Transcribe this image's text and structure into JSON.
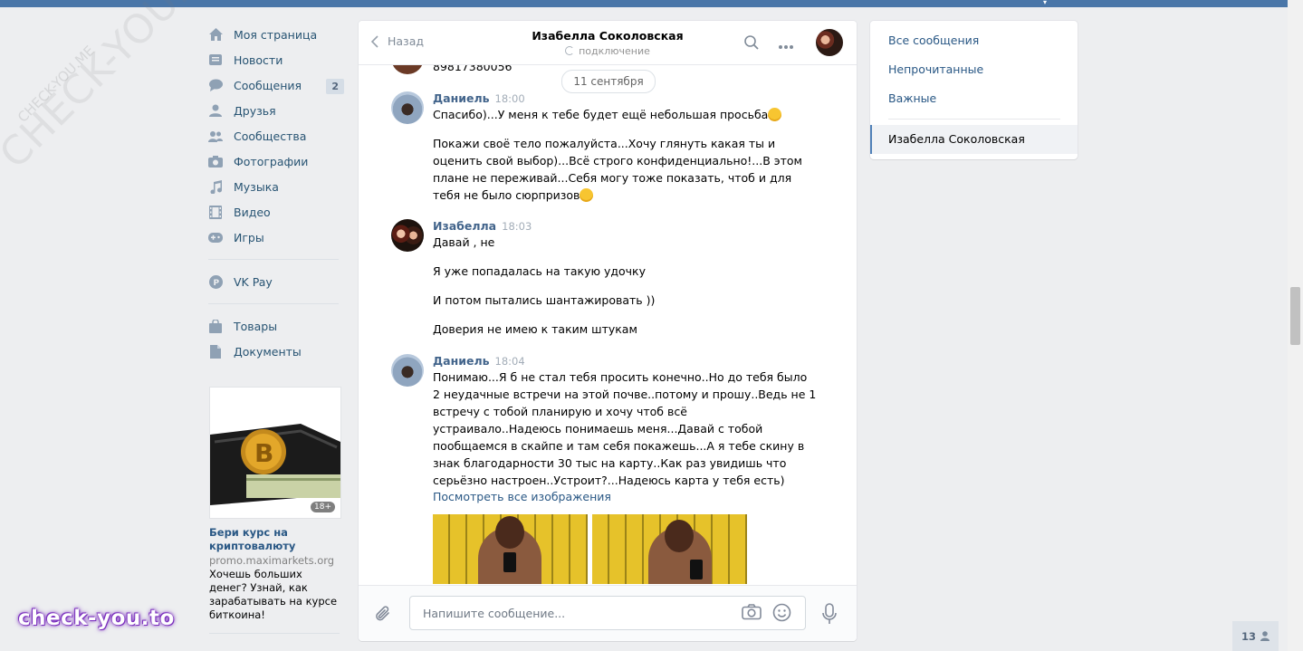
{
  "watermark": {
    "big": "CHECK-YOU.ME",
    "small": "CHECK-YOU.ME",
    "logo": "check-you.to"
  },
  "nav": {
    "items": [
      {
        "label": "Моя страница",
        "icon": "home-icon"
      },
      {
        "label": "Новости",
        "icon": "news-icon"
      },
      {
        "label": "Сообщения",
        "icon": "messages-icon",
        "badge": "2"
      },
      {
        "label": "Друзья",
        "icon": "friends-icon"
      },
      {
        "label": "Сообщества",
        "icon": "groups-icon"
      },
      {
        "label": "Фотографии",
        "icon": "camera-icon"
      },
      {
        "label": "Музыка",
        "icon": "music-icon"
      },
      {
        "label": "Видео",
        "icon": "video-icon"
      },
      {
        "label": "Игры",
        "icon": "games-icon"
      }
    ],
    "pay": {
      "label": "VK Pay",
      "icon": "vkpay-icon"
    },
    "extra": [
      {
        "label": "Товары",
        "icon": "bag-icon"
      },
      {
        "label": "Документы",
        "icon": "document-icon"
      }
    ]
  },
  "ad": {
    "age": "18+",
    "title": "Бери курс на криптовалюту",
    "domain": "promo.maximarkets.org",
    "text": "Хочешь больших денег? Узнай, как зарабатывать на курсе биткоина!"
  },
  "chat": {
    "back_label": "Назад",
    "title": "Изабелла Соколовская",
    "status": "подключение",
    "date_pill": "11 сентября",
    "cut_text": "89817380056",
    "messages": [
      {
        "author": "Даниель",
        "time": "18:00",
        "lines": [
          "Спасибо)...У меня к тебе будет ещё небольшая просьба",
          "Покажи своё тело пожалуйста...Хочу глянуть какая ты и",
          "оценить свой выбор)...Всё строго конфиденциально!...В этом",
          "плане не переживай...Себя могу тоже показать, чтоб и для",
          "тебя не было сюрпризов"
        ]
      },
      {
        "author": "Изабелла",
        "time": "18:03",
        "lines": [
          "Давай , не",
          "Я уже попадалась на такую удочку",
          "И потом пытались шантажировать ))",
          "Доверия не имею к таким штукам"
        ]
      },
      {
        "author": "Даниель",
        "time": "18:04",
        "lines": [
          "Понимаю...Я б не стал тебя просить конечно..Но до тебя было",
          "2 неудачные встречи на этой почве..потому и прошу..Ведь не 1",
          "встречу с тобой планирую и хочу чтоб всё",
          "устраивало..Надеюсь понимаешь меня...Давай с тобой",
          "пообщаемся в скайпе и там себя покажешь...А я тебе скину в",
          "знак благодарности 30 тыс на карту..Как раз увидишь что",
          "серьёзно настроен..Устроит?...Надеюсь карта у тебя есть)"
        ],
        "link": "Посмотреть все изображения"
      }
    ],
    "input_placeholder": "Напишите сообщение..."
  },
  "right_panel": {
    "items": [
      "Все сообщения",
      "Непрочитанные",
      "Важные"
    ],
    "active": "Изабелла Соколовская"
  },
  "online_count": "13"
}
